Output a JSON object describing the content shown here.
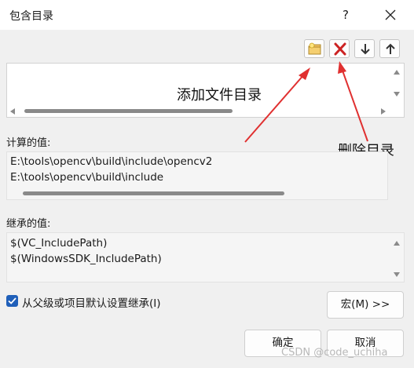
{
  "window": {
    "title": "包含目录",
    "help_label": "?"
  },
  "toolbar": {
    "new_folder_icon": "new-folder-icon",
    "delete_icon": "delete-x-icon",
    "move_down_icon": "arrow-down-icon",
    "move_up_icon": "arrow-up-icon"
  },
  "annotations": {
    "add_dir": "添加文件目录",
    "delete_dir": "删除目录"
  },
  "evaluated": {
    "label": "计算的值:",
    "lines": [
      "E:\\tools\\opencv\\build\\include\\opencv2",
      "E:\\tools\\opencv\\build\\include"
    ]
  },
  "inherited": {
    "label": "继承的值:",
    "lines": [
      "$(VC_IncludePath)",
      "$(WindowsSDK_IncludePath)"
    ]
  },
  "inherit_checkbox": {
    "label": "从父级或项目默认设置继承(I)",
    "checked": true
  },
  "buttons": {
    "macros": "宏(M) >>",
    "ok": "确定",
    "cancel": "取消"
  },
  "watermark": "CSDN @code_uchiha",
  "colors": {
    "accent": "#1f5fb9",
    "annotation_arrow": "#e03030",
    "delete_icon": "#cc2222"
  }
}
